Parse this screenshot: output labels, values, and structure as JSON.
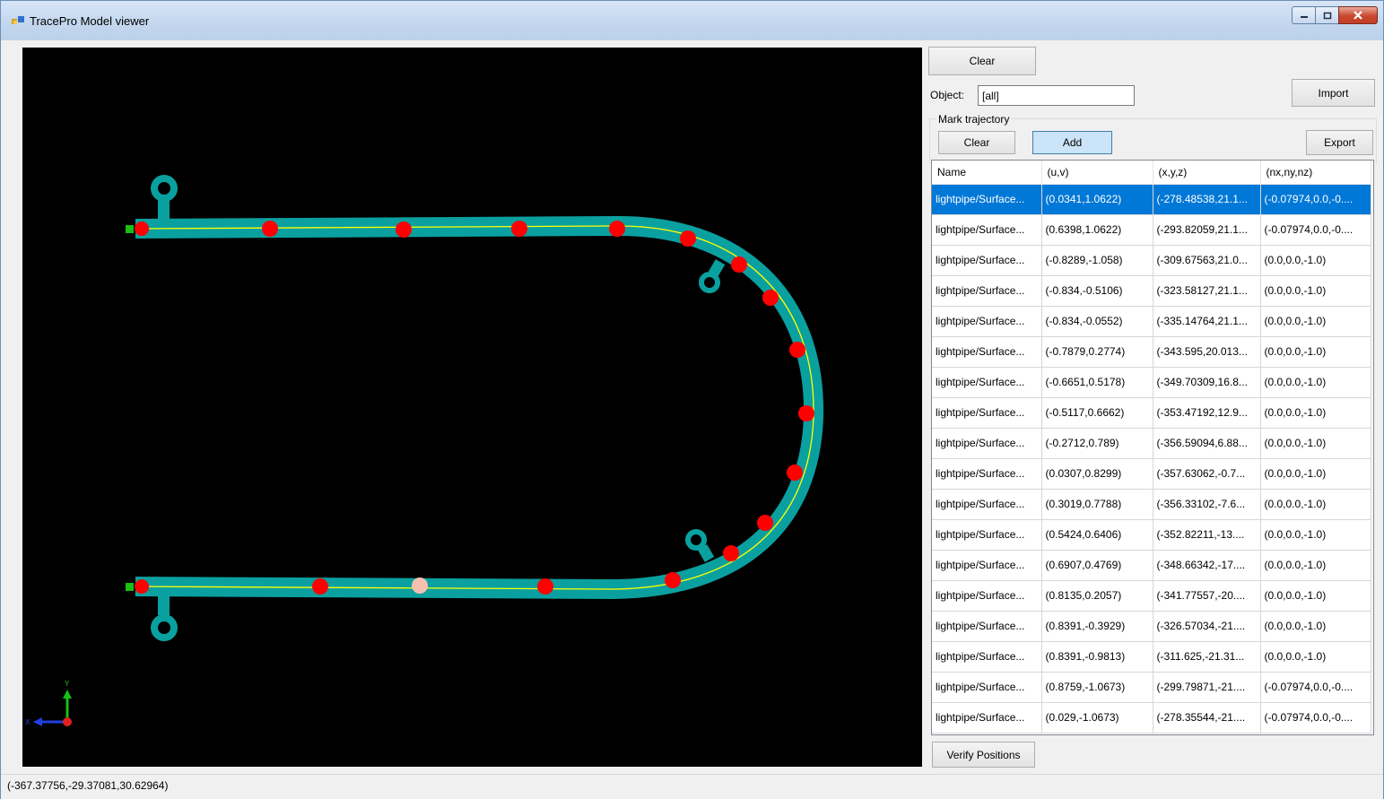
{
  "window": {
    "title": "TracePro Model viewer"
  },
  "toolbar": {
    "clear_label": "Clear",
    "object_label": "Object:",
    "object_value": "[all]",
    "import_label": "Import"
  },
  "trajectory": {
    "group_title": "Mark trajectory",
    "clear_label": "Clear",
    "add_label": "Add",
    "export_label": "Export",
    "columns": [
      "Name",
      "(u,v)",
      "(x,y,z)",
      "(nx,ny,nz)"
    ],
    "rows": [
      {
        "name": "lightpipe/Surface...",
        "uv": "(0.0341,1.0622)",
        "xyz": "(-278.48538,21.1...",
        "n": "(-0.07974,0.0,-0...."
      },
      {
        "name": "lightpipe/Surface...",
        "uv": "(0.6398,1.0622)",
        "xyz": "(-293.82059,21.1...",
        "n": "(-0.07974,0.0,-0...."
      },
      {
        "name": "lightpipe/Surface...",
        "uv": "(-0.8289,-1.058)",
        "xyz": "(-309.67563,21.0...",
        "n": "(0.0,0.0,-1.0)"
      },
      {
        "name": "lightpipe/Surface...",
        "uv": "(-0.834,-0.5106)",
        "xyz": "(-323.58127,21.1...",
        "n": "(0.0,0.0,-1.0)"
      },
      {
        "name": "lightpipe/Surface...",
        "uv": "(-0.834,-0.0552)",
        "xyz": "(-335.14764,21.1...",
        "n": "(0.0,0.0,-1.0)"
      },
      {
        "name": "lightpipe/Surface...",
        "uv": "(-0.7879,0.2774)",
        "xyz": "(-343.595,20.013...",
        "n": "(0.0,0.0,-1.0)"
      },
      {
        "name": "lightpipe/Surface...",
        "uv": "(-0.6651,0.5178)",
        "xyz": "(-349.70309,16.8...",
        "n": "(0.0,0.0,-1.0)"
      },
      {
        "name": "lightpipe/Surface...",
        "uv": "(-0.5117,0.6662)",
        "xyz": "(-353.47192,12.9...",
        "n": "(0.0,0.0,-1.0)"
      },
      {
        "name": "lightpipe/Surface...",
        "uv": "(-0.2712,0.789)",
        "xyz": "(-356.59094,6.88...",
        "n": "(0.0,0.0,-1.0)"
      },
      {
        "name": "lightpipe/Surface...",
        "uv": "(0.0307,0.8299)",
        "xyz": "(-357.63062,-0.7...",
        "n": "(0.0,0.0,-1.0)"
      },
      {
        "name": "lightpipe/Surface...",
        "uv": "(0.3019,0.7788)",
        "xyz": "(-356.33102,-7.6...",
        "n": "(0.0,0.0,-1.0)"
      },
      {
        "name": "lightpipe/Surface...",
        "uv": "(0.5424,0.6406)",
        "xyz": "(-352.82211,-13....",
        "n": "(0.0,0.0,-1.0)"
      },
      {
        "name": "lightpipe/Surface...",
        "uv": "(0.6907,0.4769)",
        "xyz": "(-348.66342,-17....",
        "n": "(0.0,0.0,-1.0)"
      },
      {
        "name": "lightpipe/Surface...",
        "uv": "(0.8135,0.2057)",
        "xyz": "(-341.77557,-20....",
        "n": "(0.0,0.0,-1.0)"
      },
      {
        "name": "lightpipe/Surface...",
        "uv": "(0.8391,-0.3929)",
        "xyz": "(-326.57034,-21....",
        "n": "(0.0,0.0,-1.0)"
      },
      {
        "name": "lightpipe/Surface...",
        "uv": "(0.8391,-0.9813)",
        "xyz": "(-311.625,-21.31...",
        "n": "(0.0,0.0,-1.0)"
      },
      {
        "name": "lightpipe/Surface...",
        "uv": "(0.8759,-1.0673)",
        "xyz": "(-299.79871,-21....",
        "n": "(-0.07974,0.0,-0...."
      },
      {
        "name": "lightpipe/Surface...",
        "uv": "(0.029,-1.0673)",
        "xyz": "(-278.35544,-21....",
        "n": "(-0.07974,0.0,-0...."
      }
    ],
    "selected_row": 0
  },
  "verify_label": "Verify Positions",
  "status": {
    "coordinates": "(-367.37756,-29.37081,30.62964)"
  },
  "viewer": {
    "axis_y": "Y",
    "axis_x": "X",
    "pipe_color": "#0aa0a0",
    "path_color": "#ffff00",
    "marker_color": "#ff0000",
    "highlight_marker_color": "#f5c0b0"
  }
}
